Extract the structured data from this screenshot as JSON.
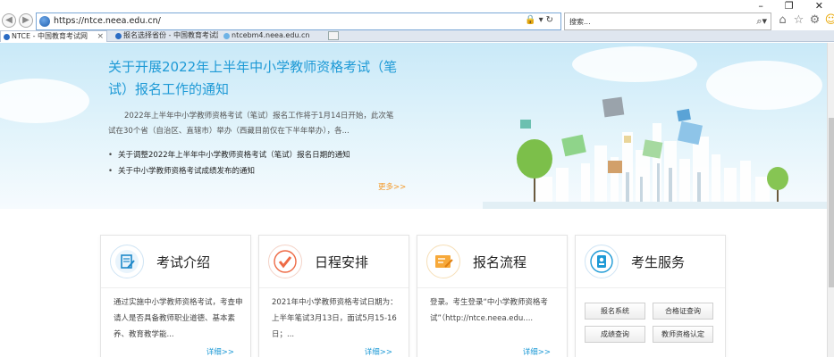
{
  "browser": {
    "url": "https://ntce.neea.edu.cn/",
    "search_placeholder": "搜索...",
    "tabs": [
      {
        "label": "NTCE - 中国教育考试网"
      },
      {
        "label": "报名选择省份 - 中国教育考试网"
      },
      {
        "label": "ntcebm4.neea.edu.cn"
      }
    ]
  },
  "banner": {
    "title": "关于开展2022年上半年中小学教师资格考试（笔试）报名工作的通知",
    "text": "2022年上半年中小学教师资格考试（笔试）报名工作将于1月14日开始，此次笔试在30个省（自治区、直辖市）举办（西藏目前仅在下半年举办），各...",
    "links": [
      "关于调整2022年上半年中小学教师资格考试（笔试）报名日期的通知",
      "关于中小学教师资格考试成绩发布的通知"
    ],
    "more": "更多>>"
  },
  "cards": [
    {
      "title": "考试介绍",
      "body": "通过实施中小学教师资格考试，考查申请人是否具备教师职业道德、基本素养、教育教学能...",
      "more": "详细>>"
    },
    {
      "title": "日程安排",
      "body": "2021年中小学教师资格考试日期为：上半年笔试3月13日，面试5月15-16日；...",
      "more": "详细>>"
    },
    {
      "title": "报名流程",
      "body": "登录。考生登录“中小学教师资格考试”（http://ntce.neea.edu....",
      "more": "详细>>"
    },
    {
      "title": "考生服务",
      "buttons": [
        "报名系统",
        "合格证查询",
        "成绩查询",
        "教师资格认定"
      ]
    }
  ],
  "colors": {
    "accent": "#1e9ad6",
    "more_orange": "#f39a2b"
  }
}
